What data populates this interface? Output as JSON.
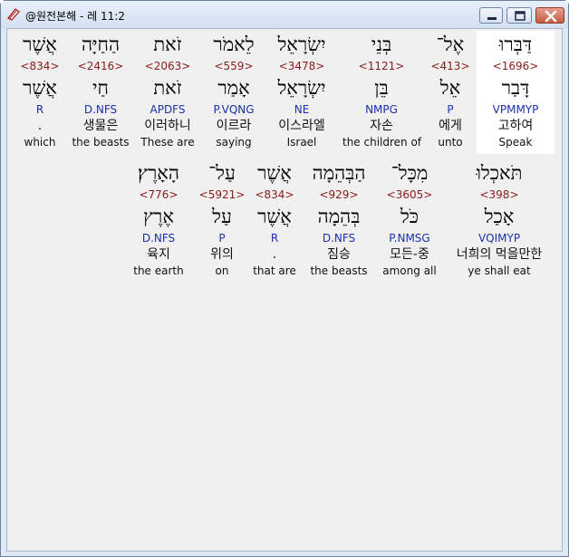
{
  "window": {
    "title": "@원전본해 - 레 11:2",
    "icon": "bible-app-icon",
    "controls": [
      "minimize-icon",
      "maximize-icon",
      "close-icon"
    ],
    "accent": "#1b2fa8",
    "strong_color": "#8b1a1a"
  },
  "rows": [
    {
      "words": [
        {
          "heb": "דַּבְּרוּ",
          "num": "<1696>",
          "lex": "דָּבַר",
          "parse": "VPMMYP",
          "kor": "고하여",
          "eng": "Speak"
        },
        {
          "heb": "אֶל־",
          "num": "<413>",
          "lex": "אֵל",
          "parse": "P",
          "kor": "에게",
          "eng": "unto"
        },
        {
          "heb": "בְּנֵי",
          "num": "<1121>",
          "lex": "בֵּן",
          "parse": "NMPG",
          "kor": "자손",
          "eng": "the children of"
        },
        {
          "heb": "יִשְׂרָאֵל",
          "num": "<3478>",
          "lex": "יִשְׂרָאֵל",
          "parse": "NE",
          "kor": "이스라엘",
          "eng": "Israel"
        },
        {
          "heb": "לֵאמֹר",
          "num": "<559>",
          "lex": "אָמַר",
          "parse": "P.VQNG",
          "kor": "이르라",
          "eng": "saying"
        },
        {
          "heb": "זֹאת",
          "num": "<2063>",
          "lex": "זֹאת",
          "parse": "APDFS",
          "kor": "이러하니",
          "eng": "These are"
        },
        {
          "heb": "הַחַיָּה",
          "num": "<2416>",
          "lex": "חַי",
          "parse": "D.NFS",
          "kor": "생물은",
          "eng": "the beasts"
        },
        {
          "heb": "אֲשֶׁר",
          "num": "<834>",
          "lex": "אֲשֶׁר",
          "parse": "R",
          "kor": ".",
          "eng": "which"
        }
      ]
    },
    {
      "words": [
        {
          "heb": "תֹּאכְלוּ",
          "num": "<398>",
          "lex": "אָכַל",
          "parse": "VQIMYP",
          "kor": "너희의 먹을만한",
          "eng": "ye shall eat"
        },
        {
          "heb": "מִכָּל־",
          "num": "<3605>",
          "lex": "כֹּל",
          "parse": "P.NMSG",
          "kor": "모든-중",
          "eng": "among all"
        },
        {
          "heb": "הַבְּהֵמָה",
          "num": "<929>",
          "lex": "בְּהֵמָה",
          "parse": "D.NFS",
          "kor": "짐승",
          "eng": "the beasts"
        },
        {
          "heb": "אֲשֶׁר",
          "num": "<834>",
          "lex": "אֲשֶׁר",
          "parse": "R",
          "kor": ".",
          "eng": "that are"
        },
        {
          "heb": "עַל־",
          "num": "<5921>",
          "lex": "עַל",
          "parse": "P",
          "kor": "위의",
          "eng": "on"
        },
        {
          "heb": "הָאָרֶץ׃",
          "num": "<776>",
          "lex": "אֶרֶץ",
          "parse": "D.NFS",
          "kor": "육지",
          "eng": "the earth"
        }
      ]
    }
  ]
}
